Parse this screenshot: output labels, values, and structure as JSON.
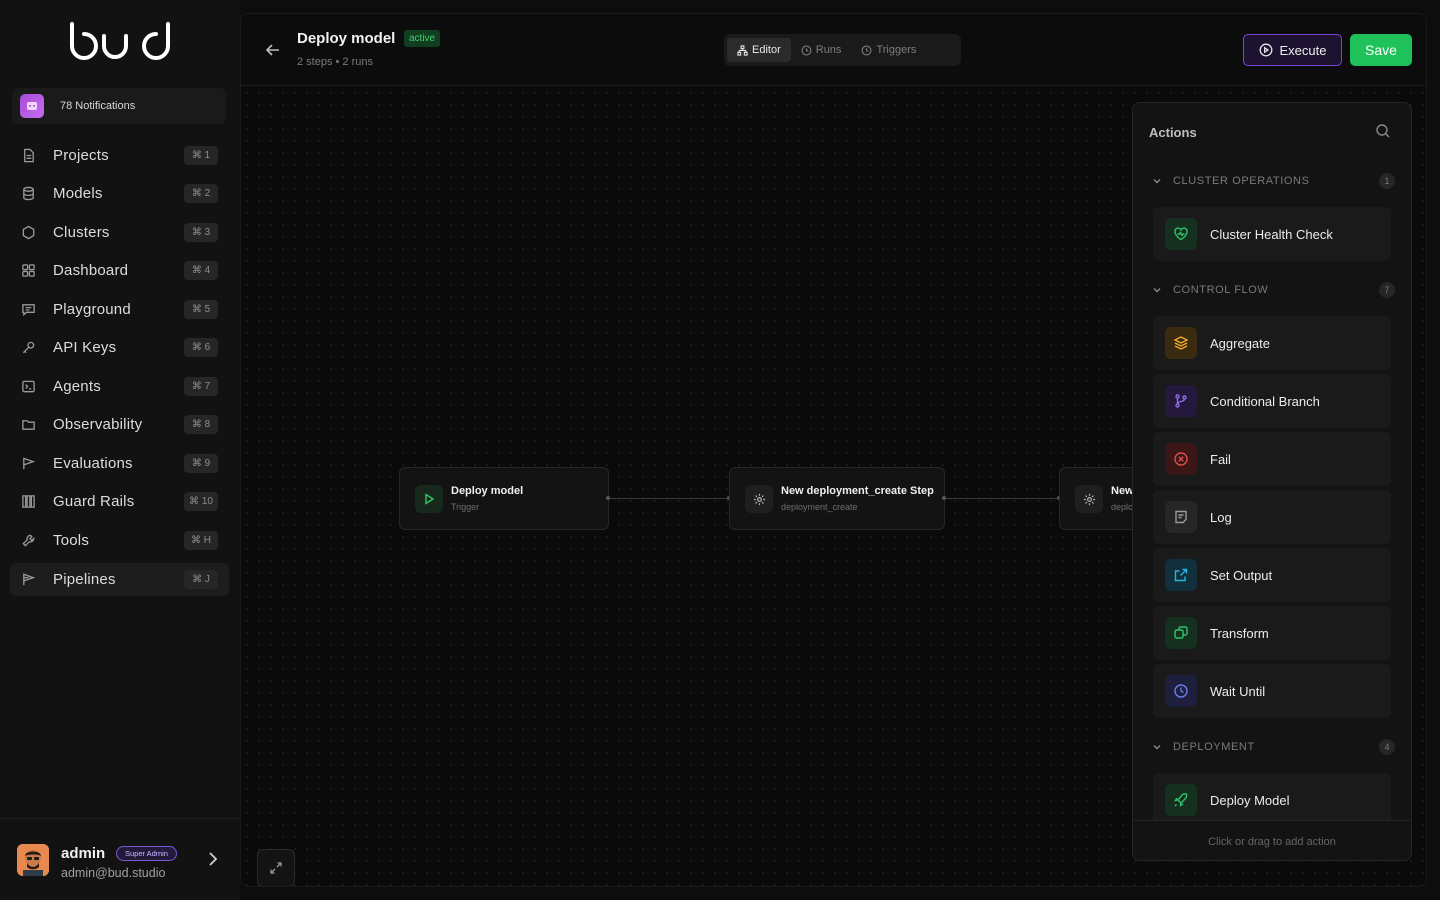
{
  "brand": {
    "logo_text": "bud"
  },
  "notifications": {
    "label": "78 Notifications"
  },
  "nav": [
    {
      "id": "projects",
      "label": "Projects",
      "shortcut": "⌘ 1",
      "icon": "file-icon"
    },
    {
      "id": "models",
      "label": "Models",
      "shortcut": "⌘ 2",
      "icon": "database-icon"
    },
    {
      "id": "clusters",
      "label": "Clusters",
      "shortcut": "⌘ 3",
      "icon": "cluster-icon"
    },
    {
      "id": "dashboard",
      "label": "Dashboard",
      "shortcut": "⌘ 4",
      "icon": "grid-icon"
    },
    {
      "id": "playground",
      "label": "Playground",
      "shortcut": "⌘ 5",
      "icon": "chat-icon"
    },
    {
      "id": "api-keys",
      "label": "API Keys",
      "shortcut": "⌘ 6",
      "icon": "key-icon"
    },
    {
      "id": "agents",
      "label": "Agents",
      "shortcut": "⌘ 7",
      "icon": "terminal-icon"
    },
    {
      "id": "observability",
      "label": "Observability",
      "shortcut": "⌘ 8",
      "icon": "folder-icon"
    },
    {
      "id": "evaluations",
      "label": "Evaluations",
      "shortcut": "⌘ 9",
      "icon": "flag-icon"
    },
    {
      "id": "guard-rails",
      "label": "Guard Rails",
      "shortcut": "⌘ 10",
      "icon": "bars-icon"
    },
    {
      "id": "tools",
      "label": "Tools",
      "shortcut": "⌘ H",
      "icon": "wrench-icon"
    },
    {
      "id": "pipelines",
      "label": "Pipelines",
      "shortcut": "⌘ J",
      "icon": "pipeline-icon",
      "active": true
    }
  ],
  "user": {
    "name": "admin",
    "role": "Super Admin",
    "email": "admin@bud.studio"
  },
  "header": {
    "title": "Deploy model",
    "status": "active",
    "subtitle": "2 steps • 2 runs",
    "tabs": [
      {
        "id": "editor",
        "label": "Editor",
        "active": true
      },
      {
        "id": "runs",
        "label": "Runs"
      },
      {
        "id": "triggers",
        "label": "Triggers"
      }
    ],
    "execute_label": "Execute",
    "save_label": "Save"
  },
  "canvas": {
    "nodes": [
      {
        "id": "trigger",
        "title": "Deploy model",
        "subtitle": "Trigger",
        "icon": "play-icon"
      },
      {
        "id": "step1",
        "title": "New deployment_create Step",
        "subtitle": "deployment_create",
        "icon": "gear-icon"
      },
      {
        "id": "step2",
        "title": "New",
        "subtitle": "deplo",
        "icon": "gear-icon"
      }
    ]
  },
  "actions_panel": {
    "title": "Actions",
    "footer": "Click or drag to add action",
    "sections": [
      {
        "id": "cluster-ops",
        "label": "CLUSTER OPERATIONS",
        "count": "1",
        "items": [
          {
            "label": "Cluster Health Check",
            "icon": "heart-pulse-icon",
            "color": "#2fc46b"
          }
        ]
      },
      {
        "id": "control-flow",
        "label": "CONTROL FLOW",
        "count": "7",
        "items": [
          {
            "label": "Aggregate",
            "icon": "layers-icon",
            "color": "#f0a92a"
          },
          {
            "label": "Conditional Branch",
            "icon": "git-branch-icon",
            "color": "#8b6cf0"
          },
          {
            "label": "Fail",
            "icon": "x-circle-icon",
            "color": "#e24b4b"
          },
          {
            "label": "Log",
            "icon": "log-icon",
            "color": "#8a8a8a"
          },
          {
            "label": "Set Output",
            "icon": "external-link-icon",
            "color": "#2ab3e6"
          },
          {
            "label": "Transform",
            "icon": "transform-icon",
            "color": "#2fc46b"
          },
          {
            "label": "Wait Until",
            "icon": "clock-icon",
            "color": "#6f7cf0"
          }
        ]
      },
      {
        "id": "deployment",
        "label": "DEPLOYMENT",
        "count": "4",
        "items": [
          {
            "label": "Deploy Model",
            "icon": "rocket-icon",
            "color": "#2fc46b"
          }
        ]
      }
    ]
  }
}
